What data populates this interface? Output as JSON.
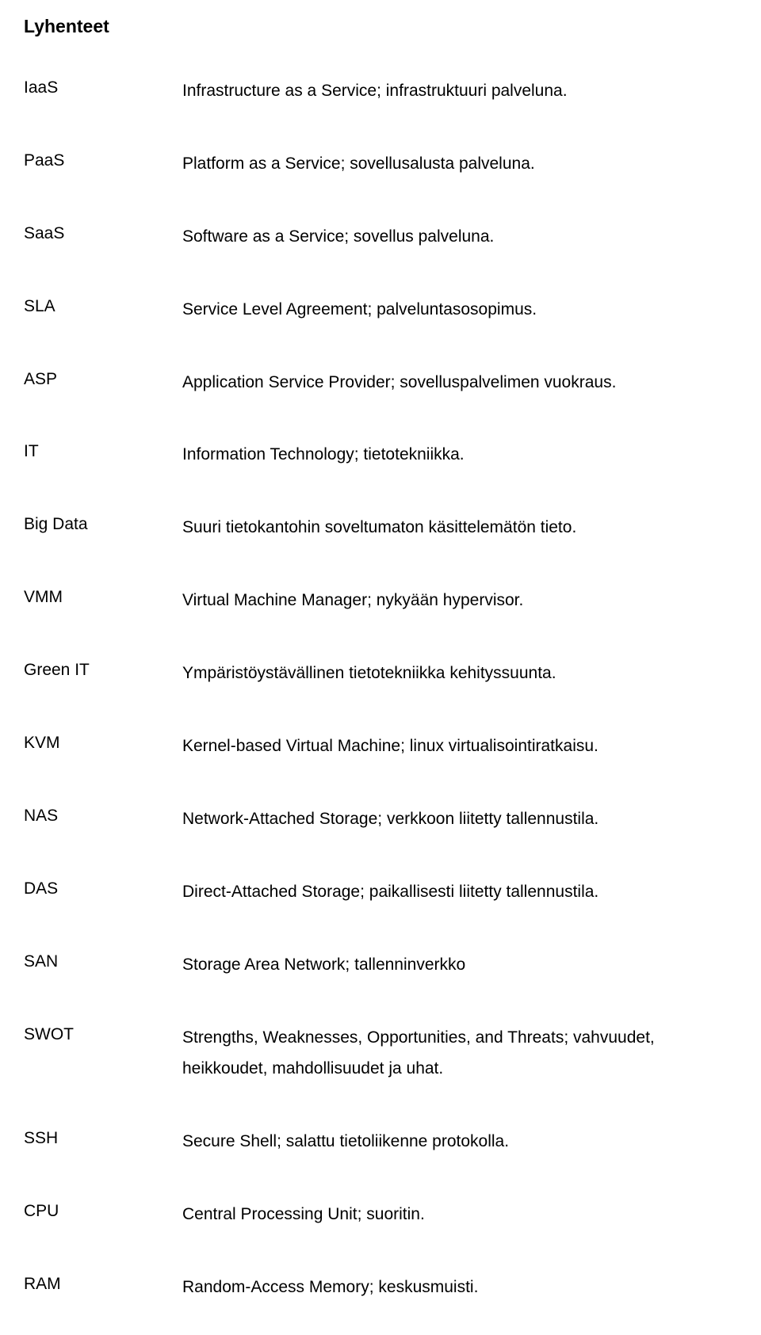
{
  "title": "Lyhenteet",
  "items": [
    {
      "term": "IaaS",
      "definition": "Infrastructure as a Service; infrastruktuuri palveluna."
    },
    {
      "term": "PaaS",
      "definition": "Platform as a Service; sovellusalusta palveluna."
    },
    {
      "term": "SaaS",
      "definition": "Software as a Service; sovellus palveluna."
    },
    {
      "term": "SLA",
      "definition": "Service Level Agreement; palveluntasosopimus."
    },
    {
      "term": "ASP",
      "definition": "Application Service Provider; sovelluspalvelimen vuokraus."
    },
    {
      "term": "IT",
      "definition": "Information Technology; tietotekniikka."
    },
    {
      "term": "Big Data",
      "definition": "Suuri tietokantohin soveltumaton käsittelemätön tieto."
    },
    {
      "term": "VMM",
      "definition": "Virtual Machine Manager; nykyään hypervisor."
    },
    {
      "term": "Green IT",
      "definition": "Ympäristöystävällinen tietotekniikka kehityssuunta."
    },
    {
      "term": "KVM",
      "definition": "Kernel-based Virtual Machine; linux virtualisointiratkaisu."
    },
    {
      "term": "NAS",
      "definition": "Network-Attached Storage; verkkoon liitetty tallennustila."
    },
    {
      "term": "DAS",
      "definition": "Direct-Attached Storage; paikallisesti liitetty tallennustila."
    },
    {
      "term": "SAN",
      "definition": "Storage Area Network; tallenninverkko"
    },
    {
      "term": "SWOT",
      "definition": "Strengths, Weaknesses, Opportunities, and Threats; vahvuudet, heikkoudet, mahdollisuudet ja uhat."
    },
    {
      "term": "SSH",
      "definition": "Secure Shell; salattu tietoliikenne protokolla."
    },
    {
      "term": "CPU",
      "definition": "Central Processing Unit; suoritin."
    },
    {
      "term": "RAM",
      "definition": "Random-Access Memory; keskusmuisti."
    }
  ]
}
